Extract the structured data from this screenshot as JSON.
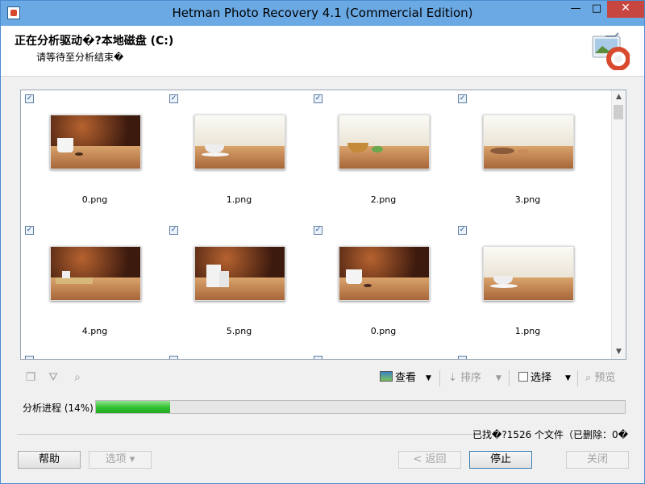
{
  "window": {
    "title": "Hetman Photo Recovery 4.1 (Commercial Edition)",
    "min": "—",
    "max": "□",
    "close": "✕"
  },
  "header": {
    "title": "正在分析驱动�?本地磁盘 (C:)",
    "subtitle": "请等待至分析结束�"
  },
  "files": [
    {
      "name": "0.png",
      "checked": true,
      "scene": "dark"
    },
    {
      "name": "1.png",
      "checked": true,
      "scene": "light"
    },
    {
      "name": "2.png",
      "checked": true,
      "scene": "light"
    },
    {
      "name": "3.png",
      "checked": true,
      "scene": "light"
    },
    {
      "name": "4.png",
      "checked": true,
      "scene": "dark"
    },
    {
      "name": "5.png",
      "checked": true,
      "scene": "dark"
    },
    {
      "name": "0.png",
      "checked": true,
      "scene": "dark"
    },
    {
      "name": "1.png",
      "checked": true,
      "scene": "light"
    }
  ],
  "toolbar": {
    "view": "查看",
    "sort": "排序",
    "select": "选择",
    "preview": "预览"
  },
  "progress": {
    "label": "分析进程 (14%)",
    "fraction": 0.14
  },
  "status": {
    "text": "已找�?1526 个文件（已删除：0�"
  },
  "buttons": {
    "help": "帮助",
    "options": "选项 ▾",
    "back": "< 返回",
    "stop": "停止",
    "close": "关闭"
  }
}
